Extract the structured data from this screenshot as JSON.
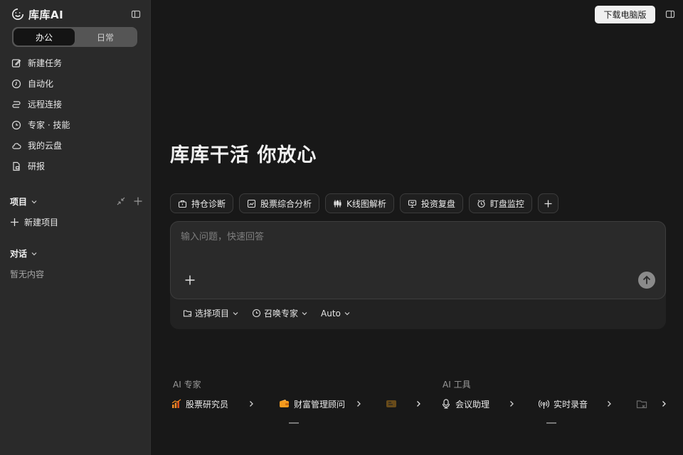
{
  "app": {
    "brand_name": "库库AI",
    "accent_color": "#f0f0f0",
    "background": "#181818",
    "sidebar_background": "#2a2a2a"
  },
  "sidebar": {
    "modes": [
      {
        "label": "办公",
        "active": true
      },
      {
        "label": "日常",
        "active": false
      }
    ],
    "nav_items": [
      {
        "label": "新建任务",
        "icon": "edit-icon"
      },
      {
        "label": "自动化",
        "icon": "clock-icon"
      },
      {
        "label": "远程连接",
        "icon": "link-icon"
      },
      {
        "label": "专家 · 技能",
        "icon": "timer-icon"
      },
      {
        "label": "我的云盘",
        "icon": "cloud-icon"
      },
      {
        "label": "研报",
        "icon": "report-icon"
      }
    ],
    "projects": {
      "title": "项目",
      "new_label": "新建项目"
    },
    "conversations": {
      "title": "对话",
      "empty_text": "暂无内容"
    }
  },
  "header": {
    "download_label": "下载电脑版"
  },
  "main": {
    "hero_title": "库库干活 你放心",
    "chips": [
      {
        "label": "持仓诊断",
        "icon": "briefcase-icon"
      },
      {
        "label": "股票综合分析",
        "icon": "chart-icon"
      },
      {
        "label": "K线图解析",
        "icon": "candlestick-icon"
      },
      {
        "label": "投资复盘",
        "icon": "presentation-icon"
      },
      {
        "label": "盯盘监控",
        "icon": "alarm-icon"
      }
    ],
    "composer": {
      "placeholder": "输入问题，快速回答",
      "options": [
        {
          "label": "选择项目",
          "icon": "folder-icon"
        },
        {
          "label": "召唤专家",
          "icon": "timer-icon"
        },
        {
          "label": "Auto",
          "icon": ""
        }
      ]
    }
  },
  "recommendations": {
    "experts_title": "AI 专家",
    "tools_title": "AI 工具",
    "experts": [
      {
        "label": "股票研究员",
        "icon": "bar-chart-icon",
        "color": "#f08a24"
      },
      {
        "label": "财富管理顾问",
        "icon": "wallet-icon",
        "color": "#f39a1e"
      }
    ],
    "tools": [
      {
        "label": "会议助理",
        "icon": "microphone-icon"
      },
      {
        "label": "实时录音",
        "icon": "broadcast-icon"
      }
    ]
  }
}
